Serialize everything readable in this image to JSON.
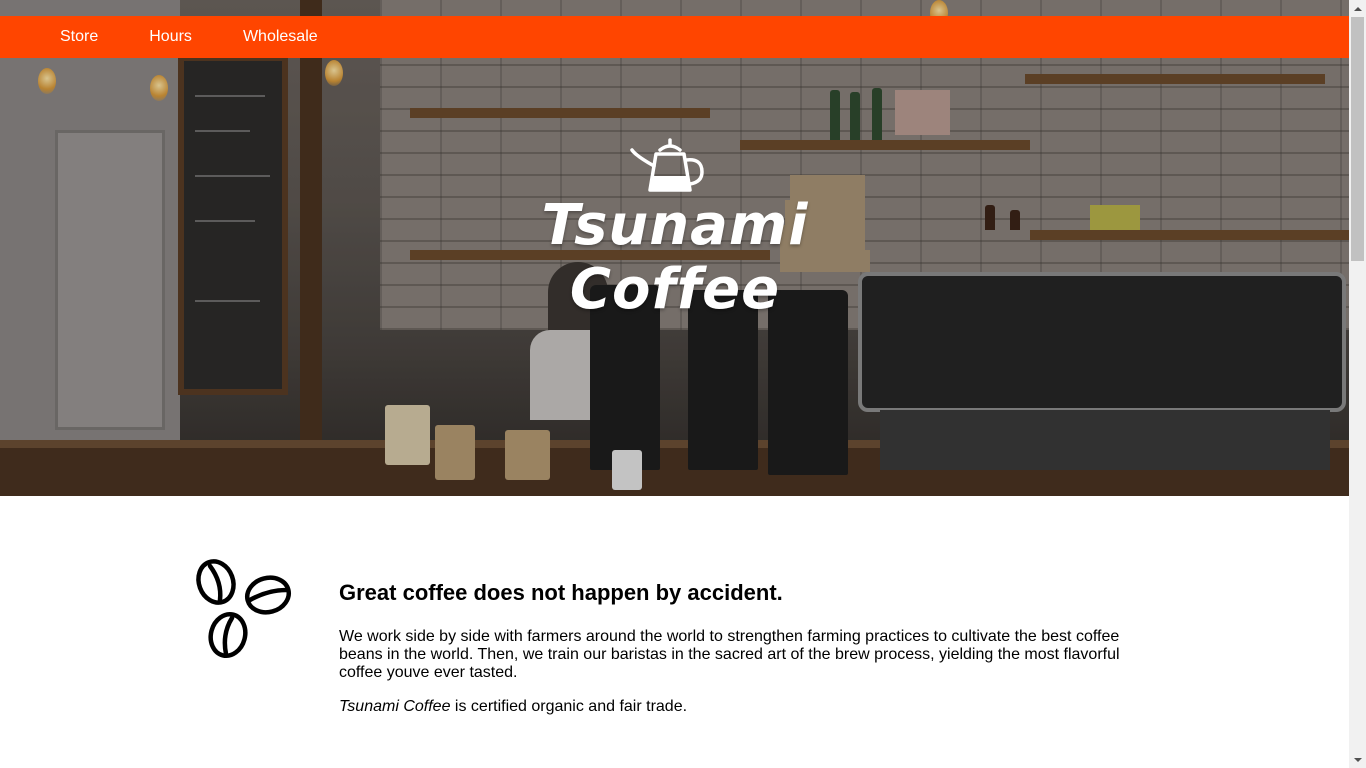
{
  "nav": {
    "items": [
      {
        "label": "Store"
      },
      {
        "label": "Hours"
      },
      {
        "label": "Wholesale"
      }
    ]
  },
  "hero": {
    "logo_line1": "Tsunami",
    "logo_line2": "Coffee",
    "logo_icon": "kettle-icon"
  },
  "content": {
    "icon": "coffee-beans-icon",
    "headline": "Great coffee does not happen by accident.",
    "paragraph": "We work side by side with farmers around the world to strengthen farming practices to cultivate the best coffee beans in the world. Then, we train our baristas in the sacred art of the brew process, yielding the most flavorful coffee youve ever tasted.",
    "cert_brand": "Tsunami Coffee",
    "cert_rest": " is certified organic and fair trade."
  },
  "colors": {
    "nav_bg": "#ff4500",
    "nav_text": "#ffffff"
  }
}
